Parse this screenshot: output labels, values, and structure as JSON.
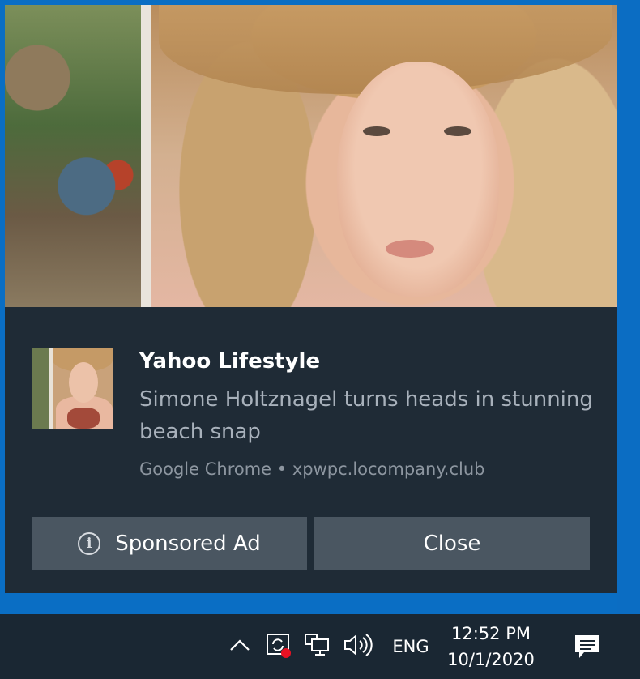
{
  "notification": {
    "app_name": "Yahoo Lifestyle",
    "message": "Simone Holtznagel turns heads in stunning beach snap",
    "attribution": "Google Chrome • xpwpc.locompany.club",
    "buttons": {
      "sponsored_label": "Sponsored Ad",
      "close_label": "Close"
    },
    "icons": {
      "info": "info-icon"
    }
  },
  "taskbar": {
    "language": "ENG",
    "time": "12:52 PM",
    "date": "10/1/2020",
    "icons": [
      "chevron-up-icon",
      "sync-icon",
      "network-icon",
      "volume-icon",
      "action-center-icon"
    ]
  },
  "colors": {
    "toast_bg": "#1f2b36",
    "button_bg": "#4a5661",
    "taskbar_bg": "#1a2733",
    "desktop": "#0b6dc3",
    "alert_dot": "#e81123"
  }
}
